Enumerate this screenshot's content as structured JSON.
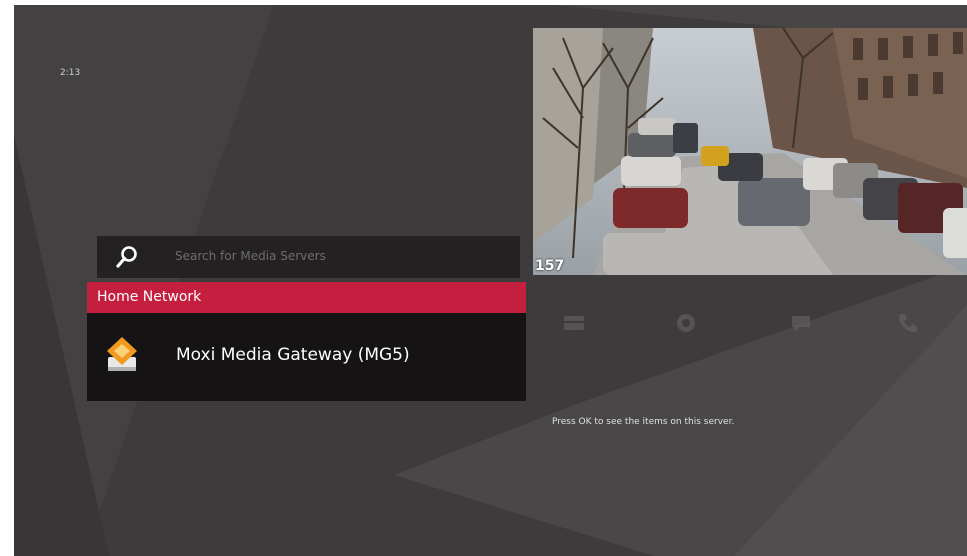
{
  "status": {
    "clock": "2:13"
  },
  "search": {
    "placeholder": "Search for Media Servers"
  },
  "sections": [
    {
      "title": "Home Network",
      "items": [
        {
          "label": "Moxi Media Gateway (MG5)",
          "icon": "media-gateway-icon"
        }
      ]
    }
  ],
  "preview": {
    "channel": "157"
  },
  "menu_icons": [
    "guide-icon",
    "settings-icon",
    "messages-icon",
    "phone-icon"
  ],
  "hint": "Press OK to see the items on this server.",
  "colors": {
    "background": "#3d3b3c",
    "accent": "#c41f3e",
    "list_background": "#151314",
    "search_background": "#232122"
  }
}
